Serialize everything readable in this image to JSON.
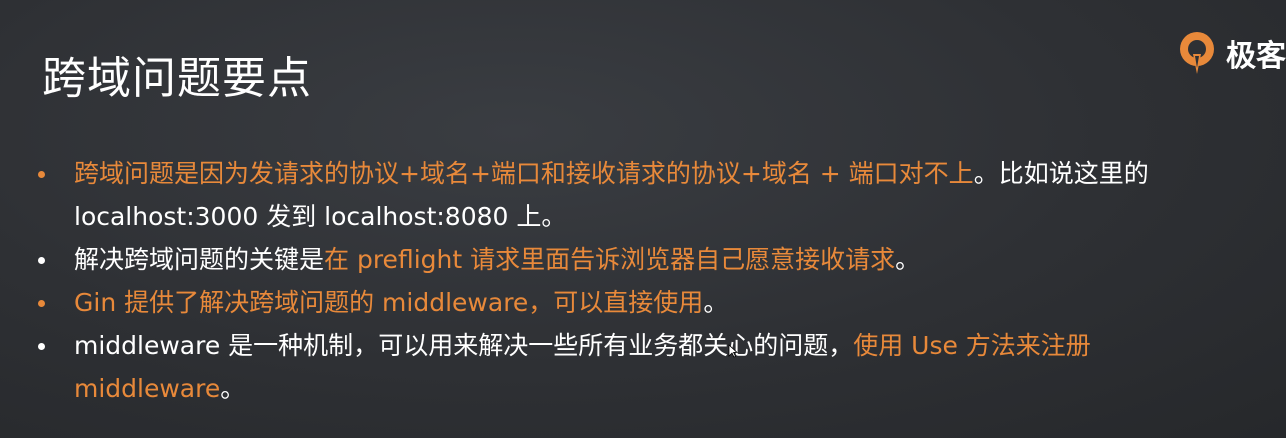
{
  "slide": {
    "title": "跨域问题要点",
    "logo_text": "极客",
    "colors": {
      "background": "#2e3034",
      "accent": "#e8893a",
      "text": "#ffffff"
    }
  },
  "bullets": [
    {
      "dot_color": "orange",
      "segments": [
        {
          "text": "跨域问题是因为发请求的协议+域名+端口和接收请求的协议+域名 + 端口对不上",
          "color": "orange"
        },
        {
          "text": "。比如说这里的 localhost:3000 发到 localhost:8080 上。",
          "color": "white"
        }
      ]
    },
    {
      "dot_color": "white",
      "segments": [
        {
          "text": "解决跨域问题的关键是",
          "color": "white"
        },
        {
          "text": "在 preflight 请求里面告诉浏览器自己愿意接收请求",
          "color": "orange"
        },
        {
          "text": "。",
          "color": "white"
        }
      ]
    },
    {
      "dot_color": "orange",
      "segments": [
        {
          "text": "Gin 提供了解决跨域问题的 middleware，可以直接使用",
          "color": "orange"
        },
        {
          "text": "。",
          "color": "white"
        }
      ]
    },
    {
      "dot_color": "white",
      "segments": [
        {
          "text": "middleware 是一种机制，可以用来解决一些所有业务都关心的问题，",
          "color": "white"
        },
        {
          "text": "使用 Use 方法来注册 middleware",
          "color": "orange"
        },
        {
          "text": "。",
          "color": "white"
        }
      ]
    }
  ]
}
